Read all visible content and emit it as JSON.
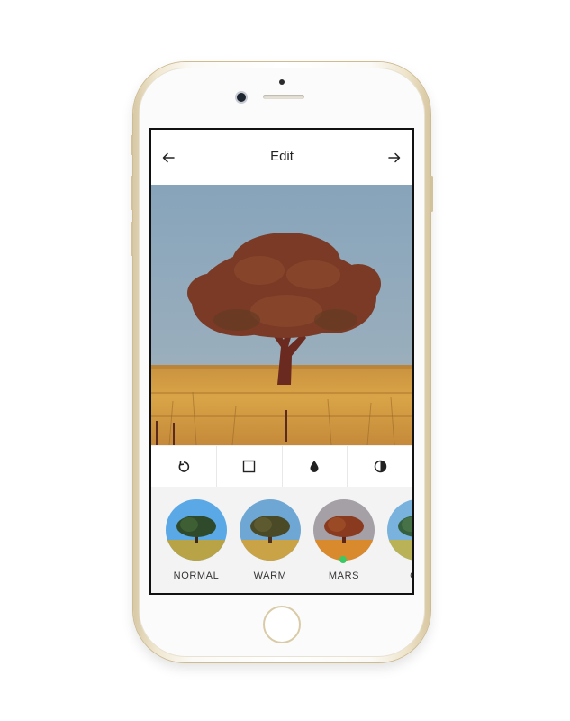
{
  "header": {
    "title": "Edit",
    "back_icon": "arrow-left-icon",
    "forward_icon": "arrow-right-icon"
  },
  "toolbar": {
    "tools": [
      {
        "name": "rotate",
        "icon": "rotate-icon"
      },
      {
        "name": "crop",
        "icon": "square-crop-icon"
      },
      {
        "name": "saturation",
        "icon": "droplet-icon"
      },
      {
        "name": "contrast",
        "icon": "contrast-icon"
      }
    ]
  },
  "filters": {
    "items": [
      {
        "label": "NORMAL"
      },
      {
        "label": "WARM"
      },
      {
        "label": "MARS",
        "selected": true
      },
      {
        "label": "CO"
      }
    ],
    "selected_color": "#3cc864"
  },
  "colors": {
    "sky": "#8fa9bd",
    "field": "#d49a3c",
    "tree": "#6e2e22"
  }
}
